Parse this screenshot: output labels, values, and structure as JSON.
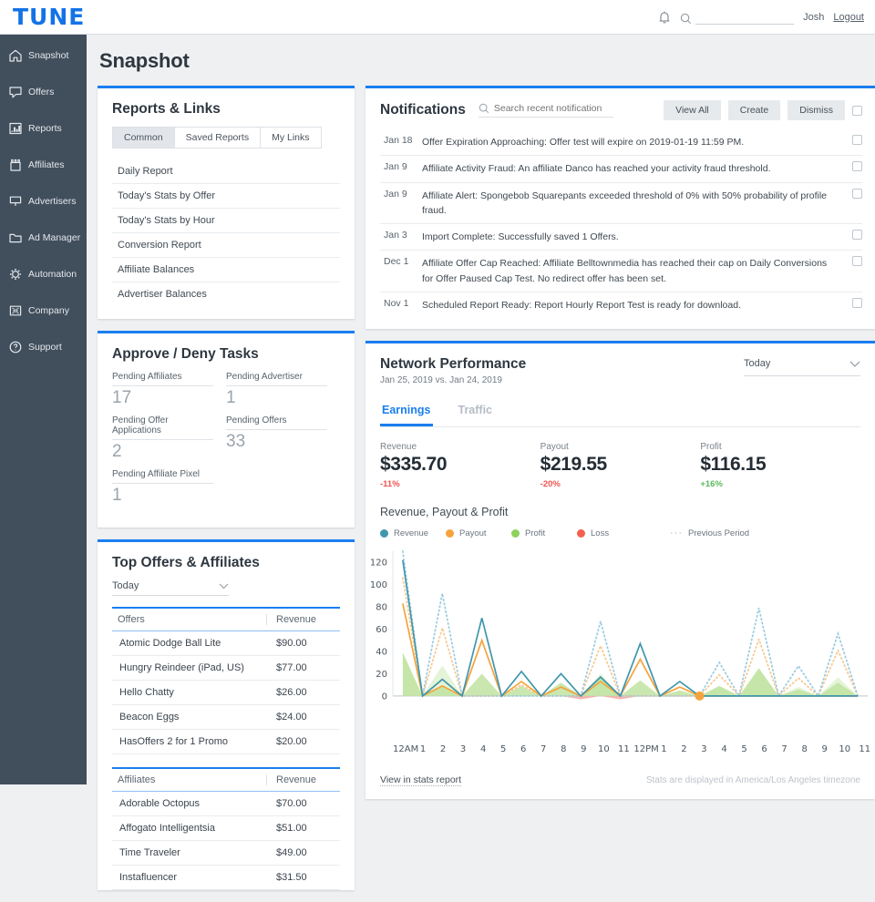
{
  "brand": {
    "logo_text": "TUNE",
    "accent": "#1a7ef0",
    "sidebar_bg": "#414e5c"
  },
  "topbar": {
    "search_placeholder": "",
    "user_name": "Josh",
    "logout_label": "Logout"
  },
  "sidebar": {
    "items": [
      {
        "label": "Snapshot",
        "icon": "home-icon"
      },
      {
        "label": "Offers",
        "icon": "tag-icon"
      },
      {
        "label": "Reports",
        "icon": "bar-chart-icon"
      },
      {
        "label": "Affiliates",
        "icon": "affiliates-icon"
      },
      {
        "label": "Advertisers",
        "icon": "advertisers-icon"
      },
      {
        "label": "Ad Manager",
        "icon": "folder-icon"
      },
      {
        "label": "Automation",
        "icon": "gear-icon"
      },
      {
        "label": "Company",
        "icon": "company-icon"
      },
      {
        "label": "Support",
        "icon": "help-icon"
      }
    ]
  },
  "page": {
    "title": "Snapshot"
  },
  "reports_links": {
    "title": "Reports & Links",
    "tabs": [
      {
        "label": "Common",
        "active": true
      },
      {
        "label": "Saved Reports",
        "active": false
      },
      {
        "label": "My Links",
        "active": false
      }
    ],
    "links": [
      "Daily Report",
      "Today's Stats by Offer",
      "Today's Stats by Hour",
      "Conversion Report",
      "Affiliate Balances",
      "Advertiser Balances"
    ]
  },
  "approve_deny": {
    "title": "Approve / Deny Tasks",
    "stats": [
      {
        "label": "Pending Affiliates",
        "value": "17"
      },
      {
        "label": "Pending Advertiser",
        "value": "1"
      },
      {
        "label": "Pending Offer Applications",
        "value": "2"
      },
      {
        "label": "Pending Offers",
        "value": "33"
      },
      {
        "label": "Pending Affiliate Pixel",
        "value": "1"
      }
    ]
  },
  "top_offers": {
    "title": "Top Offers & Affiliates",
    "period": "Today",
    "offers_header": {
      "name": "Offers",
      "revenue": "Revenue"
    },
    "offers": [
      {
        "name": "Atomic Dodge Ball Lite",
        "revenue": "$90.00"
      },
      {
        "name": "Hungry Reindeer (iPad, US)",
        "revenue": "$77.00"
      },
      {
        "name": "Hello Chatty",
        "revenue": "$26.00"
      },
      {
        "name": "Beacon Eggs",
        "revenue": "$24.00"
      },
      {
        "name": "HasOffers 2 for 1 Promo",
        "revenue": "$20.00"
      }
    ],
    "affiliates_header": {
      "name": "Affiliates",
      "revenue": "Revenue"
    },
    "affiliates": [
      {
        "name": "Adorable Octopus",
        "revenue": "$70.00"
      },
      {
        "name": "Affogato Intelligentsia",
        "revenue": "$51.00"
      },
      {
        "name": "Time Traveler",
        "revenue": "$49.00"
      },
      {
        "name": "Instafluencer",
        "revenue": "$31.50"
      }
    ]
  },
  "notifications": {
    "title": "Notifications",
    "search_placeholder": "Search recent notification",
    "buttons": {
      "view_all": "View All",
      "create": "Create",
      "dismiss": "Dismiss"
    },
    "items": [
      {
        "date": "Jan 18",
        "text": "Offer Expiration Approaching: Offer test will expire on 2019-01-19 11:59 PM."
      },
      {
        "date": "Jan 9",
        "text": "Affiliate Activity Fraud: An affiliate Danco has reached your activity fraud threshold."
      },
      {
        "date": "Jan 9",
        "text": "Affiliate Alert: Spongebob Squarepants exceeded threshold of 0% with 50% probability of profile fraud."
      },
      {
        "date": "Jan 3",
        "text": "Import Complete: Successfully saved 1 Offers."
      },
      {
        "date": "Dec 1",
        "text": "Affiliate Offer Cap Reached: Affiliate Belltownmedia has reached their cap on Daily Conversions for Offer Paused Cap Test. No redirect offer has been set."
      },
      {
        "date": "Nov 1",
        "text": "Scheduled Report Ready: Report Hourly Report Test is ready for download."
      }
    ]
  },
  "network_performance": {
    "title": "Network Performance",
    "subtitle": "Jan 25, 2019 vs. Jan 24, 2019",
    "period": "Today",
    "tabs": [
      {
        "label": "Earnings",
        "active": true
      },
      {
        "label": "Traffic",
        "active": false
      }
    ],
    "kpis": [
      {
        "label": "Revenue",
        "value": "$335.70",
        "delta": "-11%",
        "direction": "down"
      },
      {
        "label": "Payout",
        "value": "$219.55",
        "delta": "-20%",
        "direction": "down"
      },
      {
        "label": "Profit",
        "value": "$116.15",
        "delta": "+16%",
        "direction": "up"
      }
    ],
    "footer_link": "View in stats report",
    "footer_note": "Stats are displayed in America/Los Angeles timezone"
  },
  "chart_data": {
    "type": "area",
    "title": "Revenue, Payout & Profit",
    "xlabel": "",
    "ylabel": "",
    "ylim": [
      0,
      130
    ],
    "yticks": [
      0,
      20,
      40,
      60,
      80,
      100,
      120
    ],
    "grid": false,
    "legend_position": "top",
    "legend": [
      {
        "name": "Revenue",
        "color": "#3f97ad"
      },
      {
        "name": "Payout",
        "color": "#f5a33c"
      },
      {
        "name": "Profit",
        "color": "#8ed15d"
      },
      {
        "name": "Loss",
        "color": "#f4604f"
      },
      {
        "name": "Previous Period",
        "color": "#a9b2ba",
        "style": "dotted"
      }
    ],
    "categories": [
      "12AM",
      "1",
      "2",
      "3",
      "4",
      "5",
      "6",
      "7",
      "8",
      "9",
      "10",
      "11",
      "12PM",
      "1",
      "2",
      "3",
      "4",
      "5",
      "6",
      "7",
      "8",
      "9",
      "10",
      "11"
    ],
    "series": [
      {
        "name": "Revenue",
        "color": "#3f97ad",
        "style": "solid",
        "values": [
          122,
          0,
          15,
          0,
          70,
          0,
          22,
          0,
          20,
          0,
          17,
          0,
          47,
          0,
          13,
          0,
          0,
          0,
          0,
          0,
          0,
          0,
          0,
          0
        ]
      },
      {
        "name": "Payout",
        "color": "#f5a33c",
        "style": "solid",
        "values": [
          83,
          0,
          9,
          0,
          50,
          0,
          13,
          0,
          8,
          0,
          13,
          0,
          33,
          0,
          8,
          0,
          0,
          0,
          0,
          0,
          0,
          0,
          0,
          0
        ]
      },
      {
        "name": "Profit",
        "color": "#8ed15d",
        "style": "area",
        "values": [
          39,
          0,
          10,
          0,
          20,
          0,
          9,
          0,
          12,
          0,
          17,
          0,
          14,
          0,
          5,
          0,
          9,
          0,
          25,
          0,
          6,
          0,
          12,
          0
        ]
      },
      {
        "name": "Loss",
        "color": "#f4604f",
        "style": "area",
        "values": [
          0,
          0,
          0,
          0,
          0,
          0,
          0,
          0,
          0,
          -3,
          0,
          -3,
          0,
          0,
          0,
          0,
          0,
          0,
          0,
          0,
          0,
          0,
          0,
          0
        ]
      },
      {
        "name": "Revenue Previous Period",
        "color": "#9ccbe0",
        "style": "dotted",
        "values": [
          130,
          0,
          92,
          0,
          0,
          0,
          0,
          0,
          0,
          0,
          67,
          0,
          0,
          0,
          0,
          0,
          30,
          0,
          79,
          0,
          27,
          0,
          56,
          0
        ]
      },
      {
        "name": "Payout Previous Period",
        "color": "#f7c98f",
        "style": "dotted",
        "values": [
          106,
          0,
          61,
          0,
          0,
          0,
          10,
          0,
          0,
          0,
          45,
          0,
          0,
          0,
          0,
          0,
          19,
          0,
          51,
          0,
          16,
          0,
          41,
          0
        ]
      }
    ],
    "marker": {
      "series": "Payout",
      "category": "3",
      "color": "#f5a33c"
    }
  }
}
